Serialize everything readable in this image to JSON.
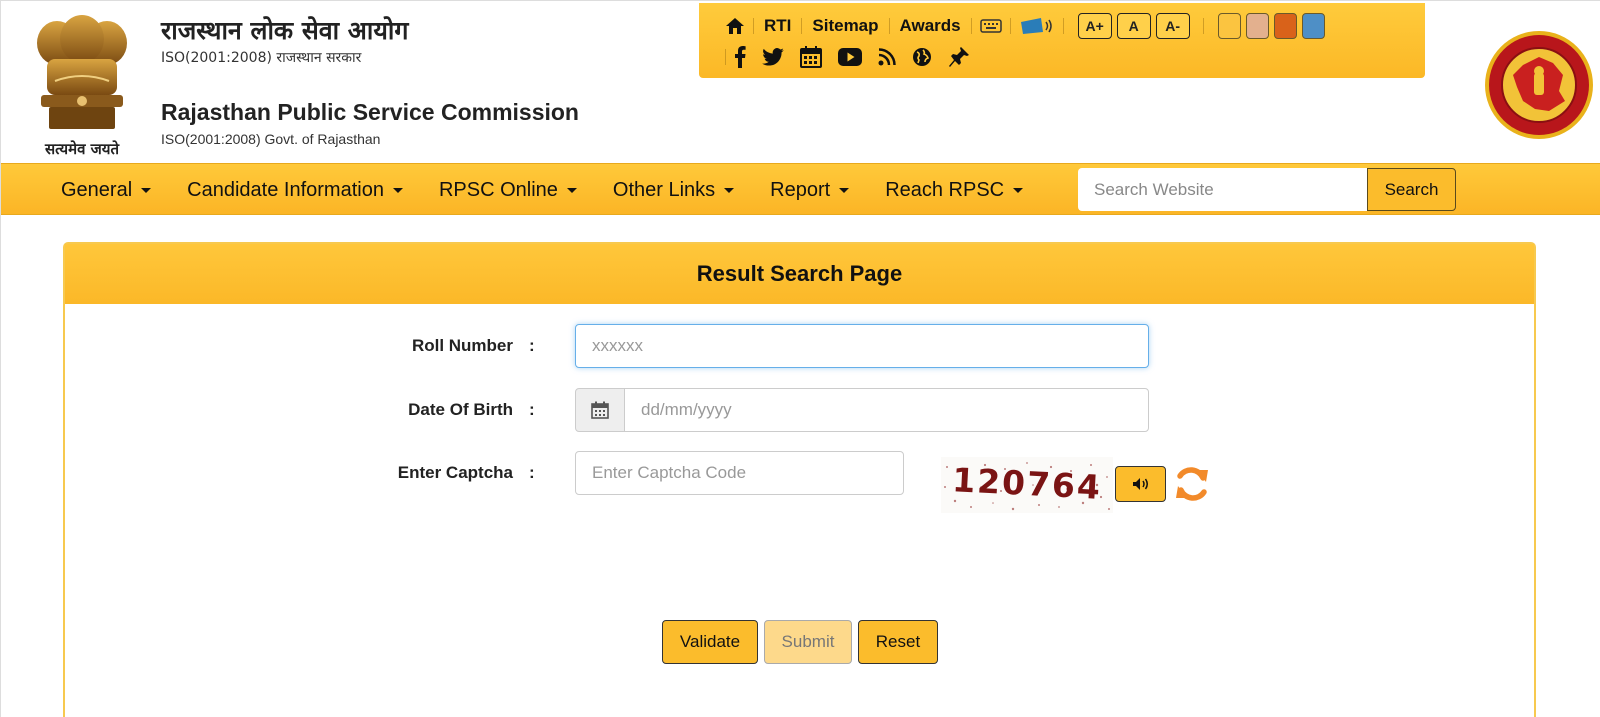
{
  "header": {
    "motto": "सत्यमेव जयते",
    "hindi_title": "राजस्थान लोक सेवा आयोग",
    "hindi_subtitle": "ISO(2001:2008) राजस्थान सरकार",
    "english_title": "Rajasthan Public Service Commission",
    "english_subtitle": "ISO(2001:2008) Govt. of Rajasthan"
  },
  "topbar": {
    "links": [
      "RTI",
      "Sitemap",
      "Awards"
    ],
    "font_buttons": [
      "A+",
      "A",
      "A-"
    ],
    "theme_swatches": [
      "#fbc440",
      "#e3b08e",
      "#d9621a",
      "#4e8fc6"
    ],
    "icons": [
      "home-icon",
      "keyboard-icon",
      "screen-reader-icon",
      "facebook-icon",
      "twitter-icon",
      "calendar-icon",
      "youtube-icon",
      "rss-icon",
      "globe-icon",
      "pin-icon"
    ]
  },
  "nav": {
    "items": [
      "General",
      "Candidate Information",
      "RPSC Online",
      "Other Links",
      "Report",
      "Reach RPSC"
    ],
    "search_placeholder": "Search Website",
    "search_button": "Search"
  },
  "form": {
    "title": "Result Search Page",
    "roll_label": "Roll Number",
    "roll_placeholder": "xxxxxx",
    "dob_label": "Date Of Birth",
    "dob_placeholder": "dd/mm/yyyy",
    "captcha_label": "Enter Captcha",
    "captcha_placeholder": "Enter Captcha Code",
    "captcha_code": "120764",
    "colon": ":"
  },
  "buttons": {
    "validate": "Validate",
    "submit": "Submit",
    "reset": "Reset"
  },
  "colors": {
    "accent": "#fbbc2c",
    "accent_light": "#ffcb3c",
    "border": "#f7c94f"
  }
}
